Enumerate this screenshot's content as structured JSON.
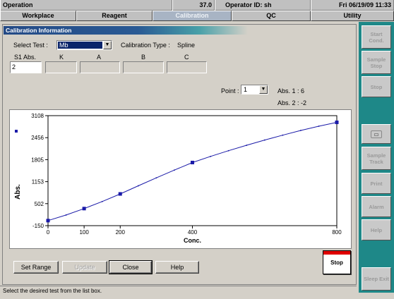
{
  "titlebar": {
    "app": "Operation",
    "value": "37.0",
    "operator": "Operator ID: sh",
    "datetime": "Fri 06/19/09 11:33"
  },
  "tabs": [
    {
      "label": "Workplace",
      "active": false
    },
    {
      "label": "Reagent",
      "active": false
    },
    {
      "label": "Calibration",
      "active": true
    },
    {
      "label": "QC",
      "active": false
    },
    {
      "label": "Utility",
      "active": false
    }
  ],
  "panel": {
    "title": "Calibration Information",
    "select_test_label": "Select Test :",
    "select_test_value": "Mb",
    "calibration_type_label": "Calibration Type :",
    "calibration_type_value": "Spline",
    "param_headers": [
      "S1 Abs.",
      "K",
      "A",
      "B",
      "C"
    ],
    "param_values": [
      "2",
      "",
      "",
      "",
      ""
    ],
    "point_label": "Point :",
    "point_value": "1",
    "abs1": "Abs. 1 :  6",
    "abs2": "Abs. 2 :  -2"
  },
  "chart_data": {
    "type": "line",
    "xlabel": "Conc.",
    "ylabel": "Abs.",
    "x_ticks": [
      "0",
      "100",
      "200",
      "400",
      "800"
    ],
    "y_ticks": [
      "3108",
      "2456",
      "1805",
      "1153",
      "502",
      "-150"
    ],
    "xlim": [
      0,
      800
    ],
    "ylim": [
      -150,
      3108
    ],
    "grid": false,
    "calibration_points": [
      {
        "x": 0,
        "y": 0
      },
      {
        "x": 100,
        "y": 356
      },
      {
        "x": 200,
        "y": 790
      },
      {
        "x": 400,
        "y": 1720
      },
      {
        "x": 800,
        "y": 2910
      }
    ],
    "curve": [
      {
        "x": 0,
        "y": 0
      },
      {
        "x": 50,
        "y": 165
      },
      {
        "x": 100,
        "y": 356
      },
      {
        "x": 150,
        "y": 565
      },
      {
        "x": 200,
        "y": 790
      },
      {
        "x": 250,
        "y": 1030
      },
      {
        "x": 300,
        "y": 1265
      },
      {
        "x": 350,
        "y": 1495
      },
      {
        "x": 400,
        "y": 1720
      },
      {
        "x": 450,
        "y": 1900
      },
      {
        "x": 500,
        "y": 2070
      },
      {
        "x": 550,
        "y": 2230
      },
      {
        "x": 600,
        "y": 2385
      },
      {
        "x": 650,
        "y": 2530
      },
      {
        "x": 700,
        "y": 2670
      },
      {
        "x": 750,
        "y": 2795
      },
      {
        "x": 800,
        "y": 2910
      }
    ],
    "legend_marker": "blue square",
    "color": "#1a1aa8"
  },
  "buttons": {
    "set_range": "Set Range",
    "update": "Update",
    "close": "Close",
    "help": "Help",
    "stop": "Stop"
  },
  "sidebar": [
    {
      "label": "Start Cond."
    },
    {
      "label": "Sample Stop"
    },
    {
      "label": "Stop"
    },
    {
      "label": "monitor-icon",
      "icon": true
    },
    {
      "label": "Sample Track"
    },
    {
      "label": "Print"
    },
    {
      "label": "Alarm"
    },
    {
      "label": "Help"
    },
    {
      "label": "Sleep Exit"
    }
  ],
  "status": "Select the desired test from the list box.",
  "colors": {
    "header_blue": "#244a86",
    "sidebar_teal": "#1e8888",
    "curve": "#1a1aa8",
    "stop_red": "#e00000"
  }
}
